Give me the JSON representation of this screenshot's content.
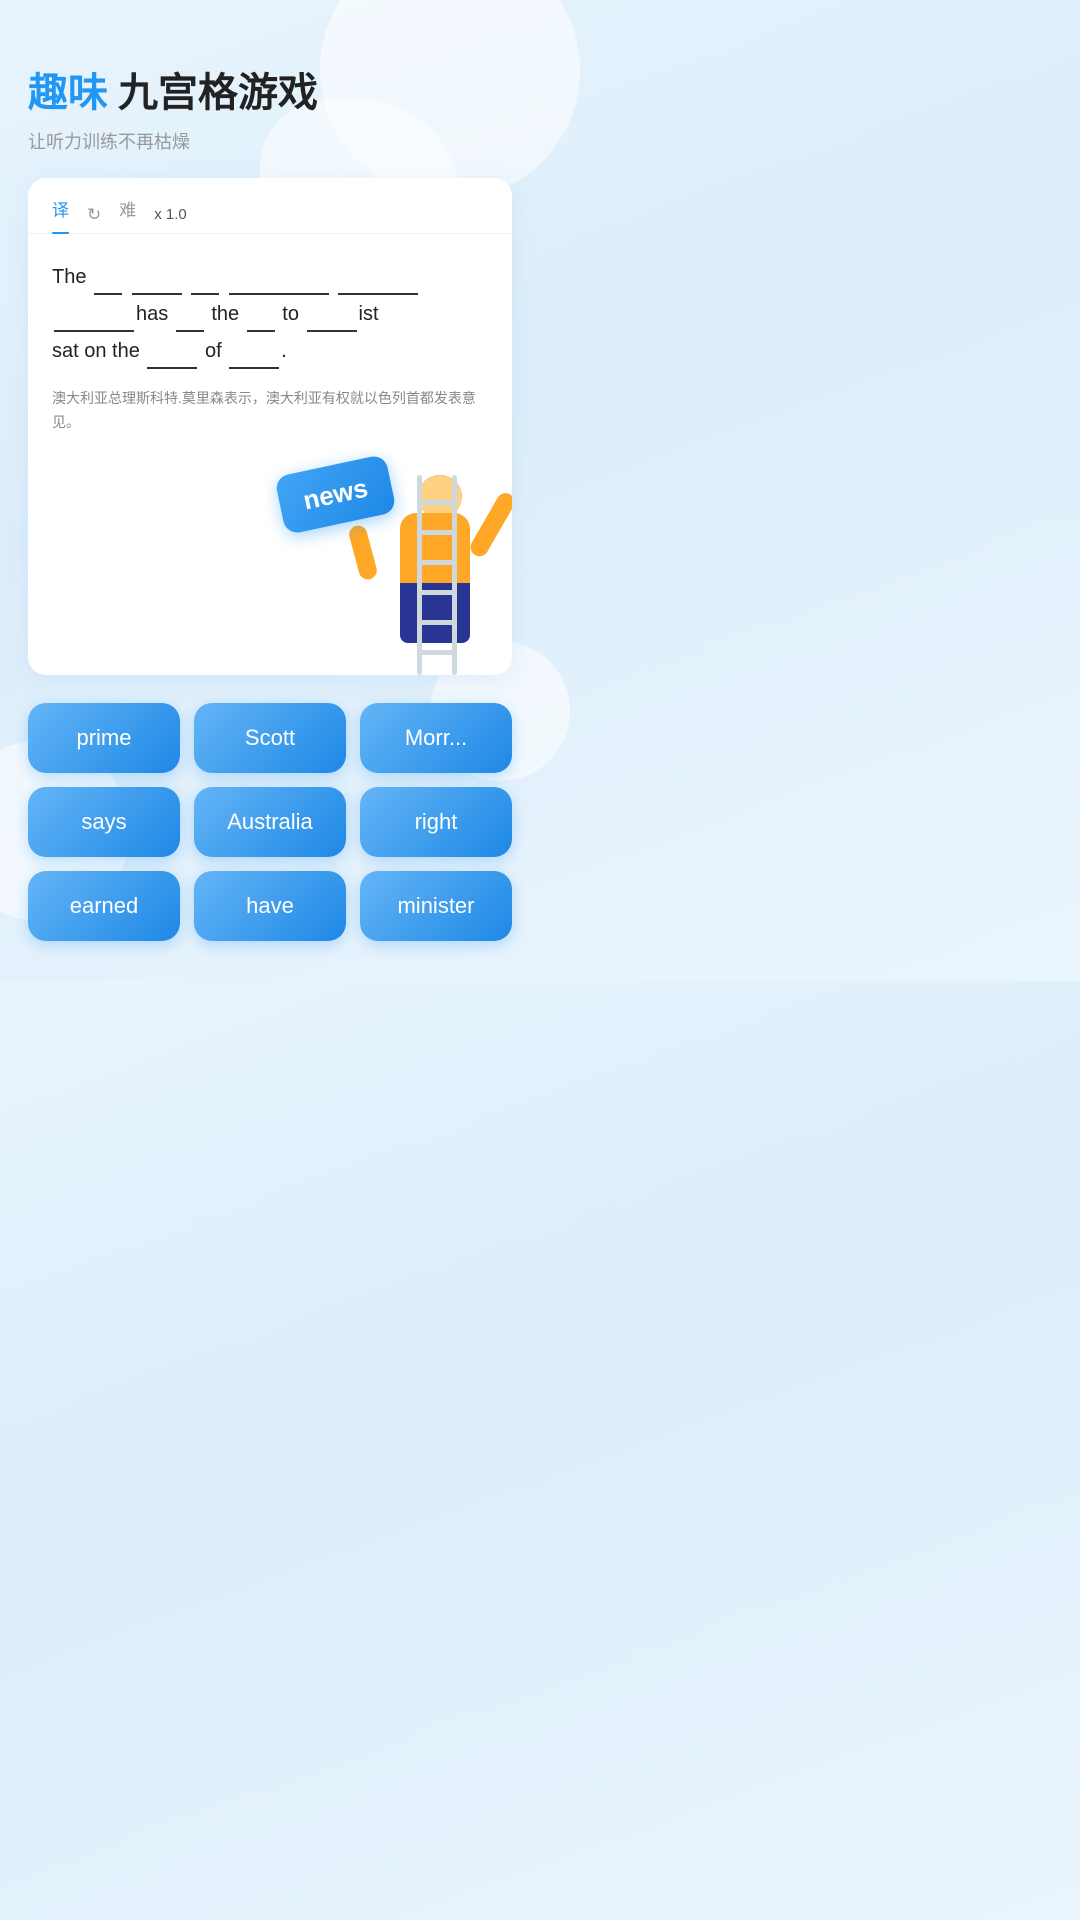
{
  "header": {
    "title_blue": "趣味",
    "title_dark": "九宫格游戏",
    "subtitle": "让听力训练不再枯燥"
  },
  "tabs": [
    {
      "id": "translate",
      "label": "译",
      "active": true
    },
    {
      "id": "refresh",
      "label": "↻",
      "active": false
    },
    {
      "id": "difficulty",
      "label": "难",
      "active": false
    },
    {
      "id": "speed",
      "label": "x 1.0",
      "active": false
    }
  ],
  "sentence": {
    "text": "The ___ ______ ___ _________ _____ ________ has ___ the ___ to _____ ist sat on the ____ of ___.",
    "display_parts": [
      "The",
      " ",
      " ",
      " ",
      " ",
      " ",
      "has",
      " ",
      "the",
      " ",
      "to",
      " ",
      "ist",
      "sat on the",
      " ",
      "of",
      " "
    ]
  },
  "translation": "澳大利亚总理斯科特.莫里森表示，澳大利亚有权就以色列首都发表意见。",
  "news_label": "news",
  "words": [
    {
      "id": "prime",
      "label": "prime"
    },
    {
      "id": "scott",
      "label": "Scott"
    },
    {
      "id": "morrison",
      "label": "Morr..."
    },
    {
      "id": "says",
      "label": "says"
    },
    {
      "id": "australia",
      "label": "Australia"
    },
    {
      "id": "right",
      "label": "right"
    },
    {
      "id": "earned",
      "label": "earned"
    },
    {
      "id": "have",
      "label": "have"
    },
    {
      "id": "minister",
      "label": "minister"
    }
  ]
}
